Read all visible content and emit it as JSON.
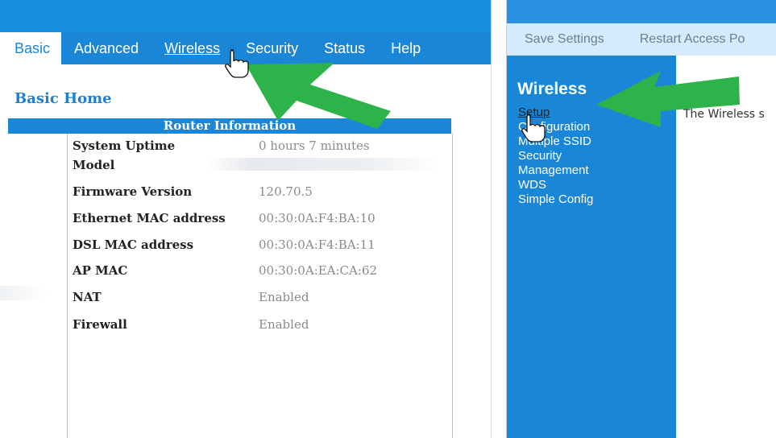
{
  "left": {
    "tabs": [
      {
        "label": "Basic"
      },
      {
        "label": "Advanced"
      },
      {
        "label": "Wireless"
      },
      {
        "label": "Security"
      },
      {
        "label": "Status"
      },
      {
        "label": "Help"
      }
    ],
    "page_title": "Basic Home",
    "section_header": "Router Information",
    "rows": [
      {
        "key": "System Uptime",
        "value": "0 hours 7 minutes"
      },
      {
        "key": "Model",
        "value": ""
      },
      {
        "key": "Firmware Version",
        "value": "120.70.5"
      },
      {
        "key": "Ethernet MAC address",
        "value": "00:30:0A:F4:BA:10"
      },
      {
        "key": "DSL MAC address",
        "value": "00:30:0A:F4:BA:11"
      },
      {
        "key": "AP MAC",
        "value": "00:30:0A:EA:CA:62"
      },
      {
        "key": "NAT",
        "value": "Enabled"
      },
      {
        "key": "Firewall",
        "value": "Enabled"
      }
    ]
  },
  "right": {
    "toolbar": [
      {
        "label": "Save Settings"
      },
      {
        "label": "Restart Access Po"
      }
    ],
    "sidebar_title": "Wireless",
    "menu": [
      {
        "label": "Setup"
      },
      {
        "label": "Configuration"
      },
      {
        "label": "Multiple SSID"
      },
      {
        "label": "Security"
      },
      {
        "label": "Management"
      },
      {
        "label": "WDS"
      },
      {
        "label": "Simple Config"
      }
    ],
    "description": "The Wireless s"
  },
  "colors": {
    "accent": "#1a86d8",
    "arrow": "#2db34a",
    "toolbar_bg": "#d4ecfb"
  },
  "icons": [
    "hand-pointer-cursor-icon",
    "green-arrow-icon"
  ]
}
